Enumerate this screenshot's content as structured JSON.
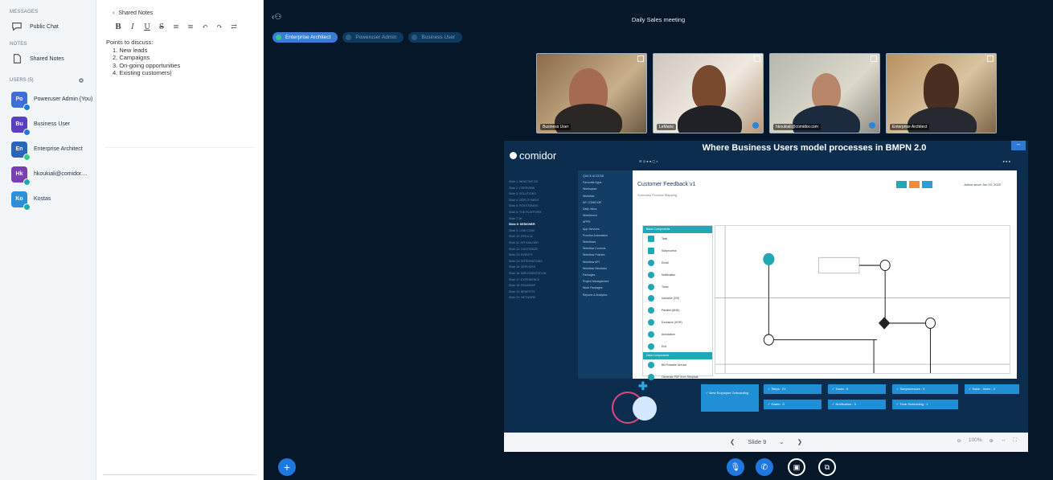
{
  "sidebar": {
    "messages_title": "MESSAGES",
    "public_chat": "Public Chat",
    "notes_title": "NOTES",
    "shared_notes": "Shared Notes",
    "users_title": "USERS (5)",
    "users": [
      {
        "initials": "Po",
        "name": "Poweruser Admin (You)",
        "color": "#3e6fd8",
        "mic": "#1f77e0"
      },
      {
        "initials": "Bu",
        "name": "Business User",
        "color": "#5a3fc0",
        "mic": "#1f77e0"
      },
      {
        "initials": "En",
        "name": "Enterprise Architect",
        "color": "#2a66b8",
        "mic": "#2ecb86"
      },
      {
        "initials": "Hk",
        "name": "hkoukiali@comidor....",
        "color": "#7a3fb0",
        "mic": "#1fa8b6"
      },
      {
        "initials": "Ko",
        "name": "Kostas",
        "color": "#2f8fd6",
        "mic": "#1fa8b6"
      }
    ]
  },
  "notes": {
    "title": "Shared Notes",
    "toolbar": [
      "B",
      "I",
      "U",
      "S",
      "≡",
      "≡",
      "↶",
      "↷",
      "⇄"
    ],
    "heading": "Points to discuss:",
    "items": [
      "1. New leads",
      "2. Campaigns",
      "3. On-going opportunities",
      "4. Existing customers"
    ]
  },
  "meeting": {
    "title": "Daily Sales meeting",
    "talkers": [
      {
        "label": "Enterprise Architect",
        "active": true
      },
      {
        "label": "Poweruser Admin",
        "active": false
      },
      {
        "label": "Business User",
        "active": false
      }
    ],
    "webcams": [
      {
        "name": "Business User"
      },
      {
        "name": "LeMarie"
      },
      {
        "name": "hkoukiali@comidor.com"
      },
      {
        "name": "Enterprise Architect"
      }
    ]
  },
  "slide": {
    "logo": "comidor",
    "title": "Where Business Users model processes in BMPN 2.0",
    "nav": [
      "Slide 1: WHAT WE DO",
      "Slide 2: OVERVIEW",
      "Slide 3: SOLUTIONS",
      "Slide 4: DEPLOYMENT",
      "Slide 5: POSITIONING",
      "Slide 6: THE PLATFORM",
      "Slide 7: AI",
      "Slide 8: DESIGNER",
      "Slide 9: LOW CODE",
      "Slide 10: RPA & AI",
      "Slide 11: API BUILDER",
      "Slide 12: CUSTOMIZE",
      "Slide 13: EVENTS",
      "Slide 14: INTEGRATIONS",
      "Slide 15: SERVICES",
      "Slide 16: IMPLEMENTATION",
      "Slide 17: EXPERIENCE",
      "Slide 18: ROADMAP",
      "Slide 19: BENEFITS",
      "Slide 20: NETWORK"
    ],
    "nav_current": 7,
    "app": {
      "form_title": "Customer Feedback v1",
      "tabs": "Summary      Process Mapping",
      "date": "Active since Jun 20, 2020",
      "side": [
        "QUICK ACCESS",
        "Favourite Apps",
        "Workspace",
        "Workflow",
        "MY COMIDOR",
        "Daily Inbox",
        "Workbench",
        "APPS",
        "App Services",
        "Process Automation",
        "Workflows",
        "Workflow Controls",
        "Workflow Policies",
        "Workflow API",
        "Workflow Simulator",
        "Packages",
        "Project Management",
        "Work Packages",
        "Reports & Analytics"
      ],
      "palette_head": "Basic Components",
      "palette": [
        "Task",
        "Subprocess",
        "Email",
        "Notification",
        "Timer",
        "Inclusive (OR)",
        "Parallel (AND)",
        "Exclusive (XOR)",
        "Annotation",
        "End"
      ],
      "palette_head2": "Data Components",
      "palette2": [
        "Bill Portable Service",
        "Generate PDF from Template"
      ]
    },
    "stats": [
      {
        "label": "✓ New Employee Onboarding"
      },
      {
        "label": "✓ Steps : 21"
      },
      {
        "label": "✓ Tasks : 9"
      },
      {
        "label": "✓ Subprocesses : 3"
      },
      {
        "label": "✓ Swim - lanes : 3"
      },
      {
        "label": "✓ Gates : 5"
      },
      {
        "label": "✓ Notification : 3"
      },
      {
        "label": "✓ Time Scheduling : 1"
      }
    ]
  },
  "controls": {
    "prev": "❮",
    "slide_label": "Slide 9",
    "next": "❯",
    "zoom": "100%"
  }
}
